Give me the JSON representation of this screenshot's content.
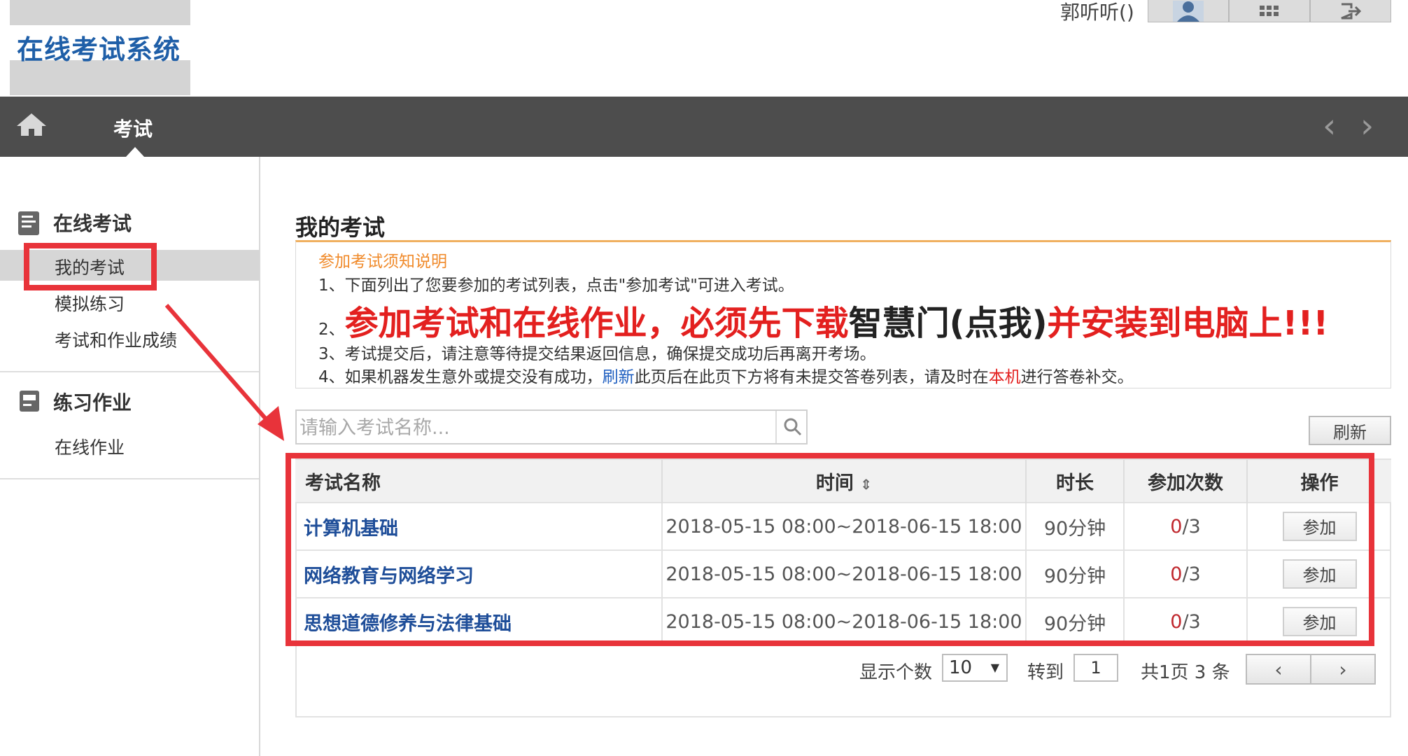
{
  "header": {
    "logo_text": "在线考试系统",
    "user_name": "郭听听()"
  },
  "nav": {
    "home_icon": "home-icon",
    "tab_label": "考试",
    "prev_arrow": "‹",
    "next_arrow": "›"
  },
  "sidebar": {
    "sections": [
      {
        "title": "在线考试",
        "icon": "exam-list-icon",
        "items": [
          "我的考试",
          "模拟练习",
          "考试和作业成绩"
        ]
      },
      {
        "title": "练习作业",
        "icon": "homework-icon",
        "items": [
          "在线作业"
        ]
      }
    ],
    "active_item": "我的考试"
  },
  "main": {
    "title": "我的考试",
    "notice": {
      "heading": "参加考试须知说明",
      "line1": "1、下面列出了您要参加的考试列表，点击\"参加考试\"可进入考试。",
      "line2_num": "2、",
      "line2_red_a": "参加考试和在线作业，必须先下载",
      "line2_link": "智慧门(点我)",
      "line2_red_b": "并安装到电脑上!!!",
      "line3": "3、考试提交后，请注意等待提交结果返回信息，确保提交成功后再离开考场。",
      "line4_a": "4、如果机器发生意外或提交没有成功，",
      "line4_blue": "刷新",
      "line4_b": "此页后在此页下方将有未提交答卷列表，请及时在",
      "line4_red": "本机",
      "line4_c": "进行答卷补交。"
    },
    "search": {
      "placeholder": "请输入考试名称..."
    },
    "refresh_label": "刷新",
    "table": {
      "headers": [
        "考试名称",
        "时间",
        "时长",
        "参加次数",
        "操作"
      ],
      "sort_icon": "⇕",
      "rows": [
        {
          "name": "计算机基础",
          "time": "2018-05-15 08:00~2018-06-15 18:00",
          "duration": "90分钟",
          "attempts_used": "0",
          "attempts_total": "/3",
          "action": "参加"
        },
        {
          "name": "网络教育与网络学习",
          "time": "2018-05-15 08:00~2018-06-15 18:00",
          "duration": "90分钟",
          "attempts_used": "0",
          "attempts_total": "/3",
          "action": "参加"
        },
        {
          "name": "思想道德修养与法律基础",
          "time": "2018-05-15 08:00~2018-06-15 18:00",
          "duration": "90分钟",
          "attempts_used": "0",
          "attempts_total": "/3",
          "action": "参加"
        }
      ]
    },
    "pager": {
      "page_size_label": "显示个数",
      "page_size_value": "10",
      "goto_label": "转到",
      "goto_value": "1",
      "summary": "共1页 3 条",
      "prev": "‹",
      "next": "›"
    }
  },
  "colors": {
    "highlight_red": "#e8333a",
    "link_blue": "#1f4e99",
    "navbar": "#4d4d4d"
  }
}
